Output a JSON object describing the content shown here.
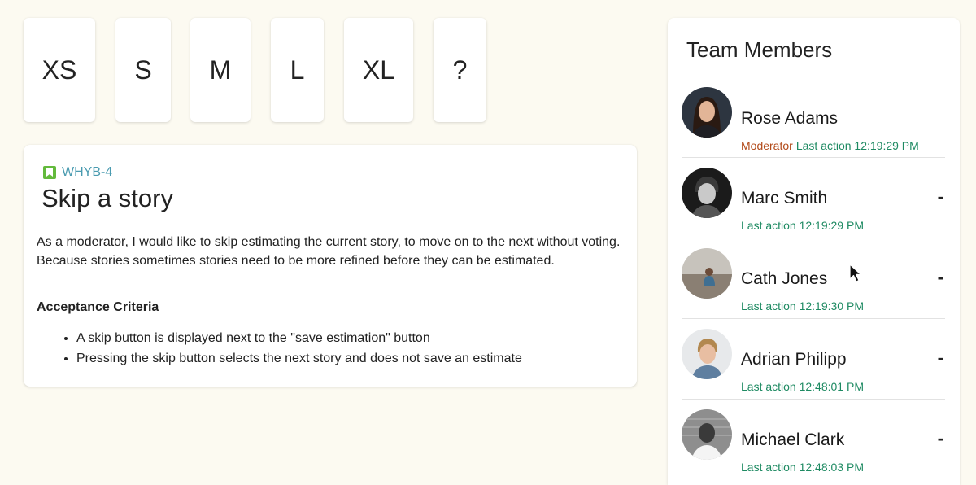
{
  "cards": [
    "XS",
    "S",
    "M",
    "L",
    "XL",
    "?"
  ],
  "story": {
    "key": "WHYB-4",
    "title": "Skip a story",
    "description": "As a moderator, I would like to skip estimating the current story, to move on to the next without voting. Because stories sometimes stories need to be more refined before they can be estimated.",
    "criteria_heading": "Acceptance Criteria",
    "criteria": [
      "A skip button is displayed next to the \"save estimation\" button",
      "Pressing the skip button selects the next story and does not save an estimate"
    ]
  },
  "team": {
    "title": "Team Members",
    "members": [
      {
        "name": "Rose Adams",
        "role": "Moderator",
        "last_action": "Last action 12:19:29 PM",
        "estimate": ""
      },
      {
        "name": "Marc Smith",
        "role": "",
        "last_action": "Last action 12:19:29 PM",
        "estimate": "-"
      },
      {
        "name": "Cath Jones",
        "role": "",
        "last_action": "Last action 12:19:30 PM",
        "estimate": "-"
      },
      {
        "name": "Adrian Philipp",
        "role": "",
        "last_action": "Last action 12:48:01 PM",
        "estimate": "-"
      },
      {
        "name": "Michael Clark",
        "role": "",
        "last_action": "Last action 12:48:03 PM",
        "estimate": "-"
      }
    ]
  },
  "colors": {
    "background": "#fcfaf1",
    "story_icon": "#63ba3c",
    "story_key": "#4a9bb0",
    "role": "#b24a1a",
    "last_action": "#1e8a62"
  },
  "icons": {
    "story": "bookmark-icon",
    "cursor": "mouse-pointer-icon"
  }
}
